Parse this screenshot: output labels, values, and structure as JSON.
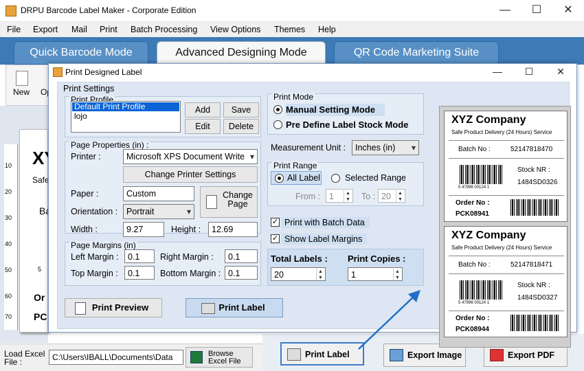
{
  "app": {
    "title": "DRPU Barcode Label Maker - Corporate Edition"
  },
  "window_controls": {
    "minimize": "—",
    "maximize": "☐",
    "close": "✕"
  },
  "menu": [
    "File",
    "Export",
    "Mail",
    "Print",
    "Batch Processing",
    "View Options",
    "Themes",
    "Help"
  ],
  "tabs": [
    "Quick Barcode Mode",
    "Advanced Designing Mode",
    "QR Code Marketing Suite"
  ],
  "toolbar": {
    "new": "New",
    "open": "Op"
  },
  "ruler": [
    "10",
    "20",
    "30",
    "40",
    "50",
    "60",
    "70"
  ],
  "canvas_peek": [
    "XY",
    "Safe",
    "Ba",
    "5",
    "Or",
    "PC"
  ],
  "dialog": {
    "title": "Print Designed Label",
    "print_settings": "Print Settings",
    "print_profile": {
      "title": "Print Profile",
      "items": [
        "Default Print Profile",
        "lojo"
      ],
      "add": "Add",
      "save": "Save",
      "edit": "Edit",
      "delete": "Delete"
    },
    "page_properties": {
      "title": "Page Properties (in) :",
      "printer_label": "Printer :",
      "printer": "Microsoft XPS Document Write",
      "change_printer": "Change Printer Settings",
      "paper_label": "Paper :",
      "paper": "Custom",
      "orientation_label": "Orientation :",
      "orientation": "Portrait",
      "change_page": "Change Page",
      "width_label": "Width :",
      "width": "9.27",
      "height_label": "Height :",
      "height": "12.69"
    },
    "page_margins": {
      "title": "Page Margins (in)",
      "left_label": "Left Margin :",
      "left": "0.1",
      "right_label": "Right Margin :",
      "right": "0.1",
      "top_label": "Top Margin :",
      "top": "0.1",
      "bottom_label": "Bottom Margin :",
      "bottom": "0.1"
    },
    "print_mode": {
      "title": "Print Mode",
      "manual": "Manual Setting Mode",
      "predefine": "Pre Define Label Stock Mode"
    },
    "measurement": {
      "label": "Measurement Unit :",
      "value": "Inches (in)"
    },
    "print_range": {
      "title": "Print Range",
      "all": "All Label",
      "selected": "Selected Range",
      "from_label": "From :",
      "from": "1",
      "to_label": "To :",
      "to": "20"
    },
    "batch_data": "Print with Batch Data",
    "show_margins": "Show Label Margins",
    "total_labels_label": "Total Labels :",
    "total_labels": "20",
    "print_copies_label": "Print Copies :",
    "print_copies": "1",
    "print_preview": "Print Preview",
    "print_label": "Print Label"
  },
  "labels": [
    {
      "company": "XYZ Company",
      "subtitle": "Safe Product Delivery (24 Hours) Service",
      "batch_label": "Batch No :",
      "batch": "52147818470",
      "stock_label": "Stock NR :",
      "stock": "1484SD0326",
      "digits": "5 47996  00124 1",
      "order_label": "Order No :",
      "order": "PCK08941"
    },
    {
      "company": "XYZ Company",
      "subtitle": "Safe Product Delivery (24 Hours) Service",
      "batch_label": "Batch No :",
      "batch": "52147818471",
      "stock_label": "Stock NR :",
      "stock": "1484SD0327",
      "digits": "5 47996  00124 1",
      "order_label": "Order No :",
      "order": "PCK08944"
    }
  ],
  "bottom": {
    "load_excel": "Load Excel File :",
    "excel_path": "C:\\Users\\IBALL\\Documents\\Data",
    "browse_excel": "Browse Excel File",
    "print_label": "Print Label",
    "export_image": "Export Image",
    "export_pdf": "Export PDF"
  }
}
